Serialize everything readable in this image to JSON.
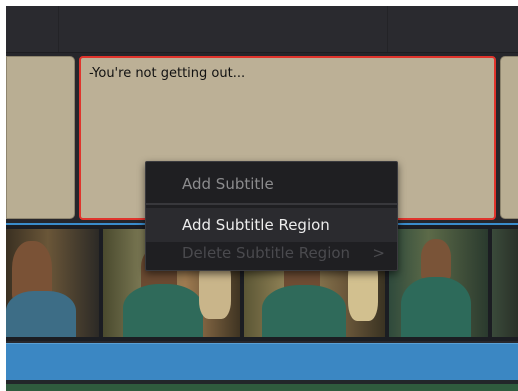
{
  "subtitle_track": {
    "selected_clip_text": "-You're not getting out..."
  },
  "context_menu": {
    "items": [
      {
        "label": "Add Subtitle",
        "state": "dimmed"
      },
      {
        "label": "Add Subtitle Region",
        "state": "highlighted"
      },
      {
        "label": "Delete Subtitle Region",
        "state": "disabled",
        "submenu_glyph": ">"
      }
    ]
  },
  "colors": {
    "timeline_bg": "#28282d",
    "subtitle_clip": "#bcb096",
    "selection_outline": "#e0342c",
    "audio_track": "#3b87c3",
    "menu_bg": "#1f1f22"
  }
}
